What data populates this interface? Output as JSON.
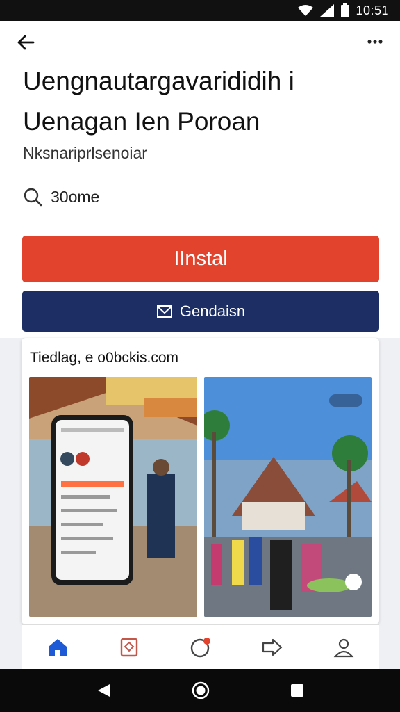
{
  "status_bar": {
    "time": "10:51"
  },
  "app": {
    "title_line1": "Uengnautargavarididih i",
    "title_line2": "Uenagan Ien Poroan",
    "subtitle": "Nksnariprlsenoiar",
    "size": "30ome"
  },
  "buttons": {
    "install": "IInstal",
    "secondary": "Gendaisn"
  },
  "gallery": {
    "caption": "Tiedlag, e o0bckis.com"
  },
  "icons": {
    "back": "back-arrow-icon",
    "more": "more-vert-icon",
    "search": "search-icon",
    "mail": "mail-icon",
    "home": "home-icon",
    "feedback": "book-icon",
    "circle": "notification-circle-icon",
    "share": "share-icon",
    "profile": "profile-icon"
  },
  "colors": {
    "install": "#e2432d",
    "secondary": "#1c2e63",
    "nav_active": "#1e5ad6"
  }
}
